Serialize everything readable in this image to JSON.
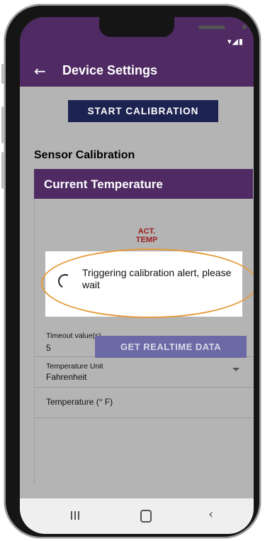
{
  "status_bar": {
    "icons_text": "▾◢▮"
  },
  "app_bar": {
    "back_icon": "back-arrow-icon",
    "title": "Device Settings"
  },
  "main": {
    "start_calibration_label": "START CALIBRATION",
    "section_title": "Sensor Calibration",
    "card": {
      "header": "Current Temperature",
      "act_temp_label": "ACT.\nTEMP",
      "fields": [
        {
          "label": "Timeout value(s)",
          "value": "5"
        },
        {
          "label": "Temperature Unit",
          "value": "Fahrenheit"
        },
        {
          "label": "Temperature (° F)"
        }
      ],
      "realtime_button_label": "GET REALTIME DATA"
    }
  },
  "dialog": {
    "message": "Triggering calibration alert, please wait"
  },
  "colors": {
    "purple": "#4f2a63",
    "navy_button": "#1d2350",
    "disabled_button": "#6c6aa6",
    "highlight": "#e59a3a"
  }
}
